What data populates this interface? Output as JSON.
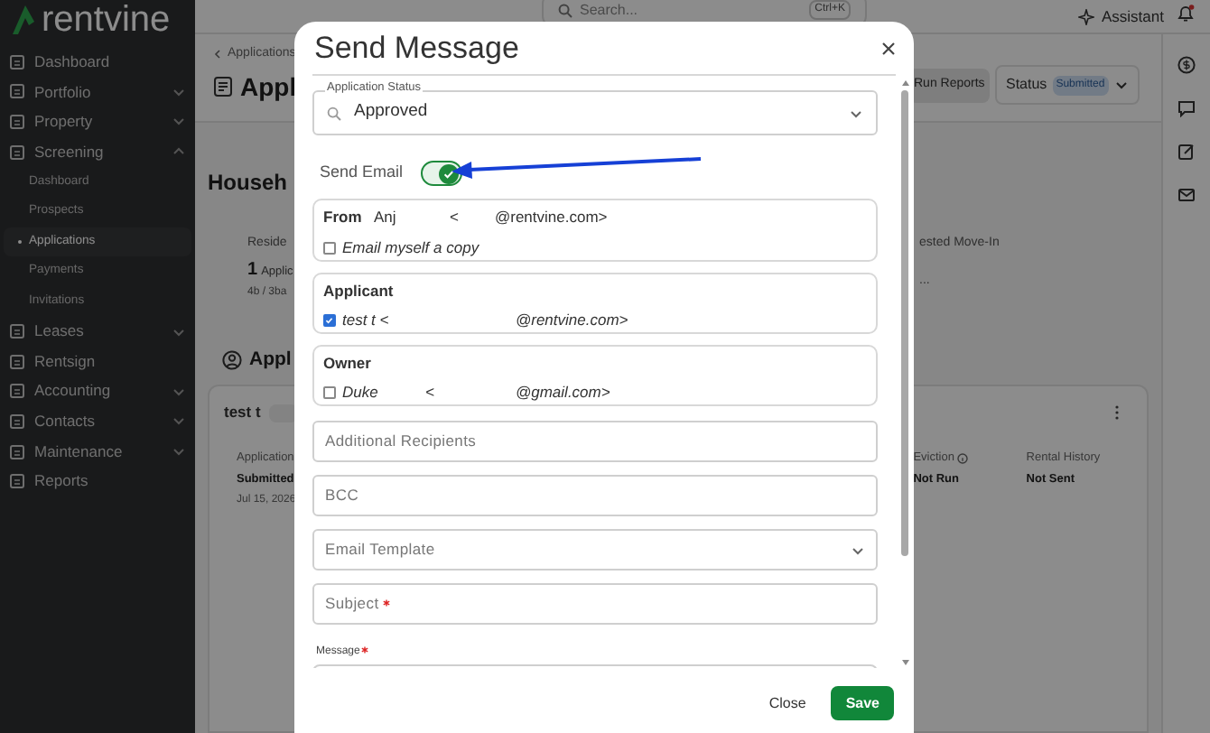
{
  "sidebar": {
    "logo": "rentvine",
    "items": [
      {
        "label": "Dashboard",
        "selected": false
      },
      {
        "label": "Portfolio",
        "selected": false,
        "expanded": false
      },
      {
        "label": "Property",
        "selected": false,
        "expanded": false
      },
      {
        "label": "Screening",
        "selected": false,
        "expanded": true,
        "children": [
          {
            "label": "Dashboard",
            "selected": false
          },
          {
            "label": "Prospects",
            "selected": false
          },
          {
            "label": "Applications",
            "selected": true
          },
          {
            "label": "Payments",
            "selected": false
          },
          {
            "label": "Invitations",
            "selected": false
          }
        ]
      },
      {
        "label": "Leases",
        "selected": false,
        "expanded": false
      },
      {
        "label": "Rentsign",
        "selected": false
      },
      {
        "label": "Accounting",
        "selected": false,
        "expanded": false
      },
      {
        "label": "Contacts",
        "selected": false,
        "expanded": false
      },
      {
        "label": "Maintenance",
        "selected": false,
        "expanded": false
      },
      {
        "label": "Reports",
        "selected": false
      }
    ]
  },
  "top_bar": {
    "search": {
      "placeholder": "Search...",
      "shortcut": "Ctrl+K"
    },
    "assistant": "Assistant",
    "notification_dot": true
  },
  "page": {
    "breadcrumb": "Applications",
    "title": "Appl",
    "run_reports": "Run Reports",
    "status_label": "Status",
    "status_badge": "Submitted",
    "household": {
      "heading": "Househ",
      "residence_label": "Reside",
      "applicants_count": "1",
      "applicants_text": "Applic",
      "unit": "4b / 3ba",
      "move_in_label": "ested Move-In",
      "move_in_value": "..."
    },
    "applicants": {
      "heading": "Appl",
      "card": {
        "name": "test t",
        "fields": [
          {
            "label": "Application",
            "value": "Submitted",
            "sub": "Jul 15, 2026",
            "info": false
          },
          {
            "label": "Eviction",
            "value": "Not Run",
            "info": true
          },
          {
            "label": "Rental History",
            "value": "Not Sent",
            "info": false
          }
        ]
      }
    }
  },
  "dialog": {
    "title": "Send Message",
    "status_field": {
      "label": "Application Status",
      "value": "Approved"
    },
    "send_email": {
      "label": "Send Email",
      "on": true
    },
    "from": {
      "label": "From",
      "name": "Anj",
      "bracket": "<",
      "address": "@rentvine.com>",
      "copy_label": "Email myself a copy",
      "copy_checked": false
    },
    "recipient_groups": [
      {
        "title": "Applicant",
        "recipients": [
          {
            "name": "test t <",
            "address": "@rentvine.com>",
            "checked": true
          }
        ]
      },
      {
        "title": "Owner",
        "recipients": [
          {
            "name": "Duke",
            "bracket": "<",
            "address": "@gmail.com>",
            "checked": false
          }
        ]
      }
    ],
    "fields": [
      {
        "kind": "text",
        "placeholder": "Additional Recipients",
        "required": false
      },
      {
        "kind": "text",
        "placeholder": "BCC",
        "required": false
      },
      {
        "kind": "select",
        "placeholder": "Email Template",
        "required": false
      },
      {
        "kind": "text",
        "placeholder": "Subject",
        "required": true
      }
    ],
    "message": {
      "label": "Message",
      "required": true
    },
    "buttons": [
      {
        "label": "Close",
        "kind": "secondary"
      },
      {
        "label": "Save",
        "kind": "primary"
      }
    ]
  }
}
